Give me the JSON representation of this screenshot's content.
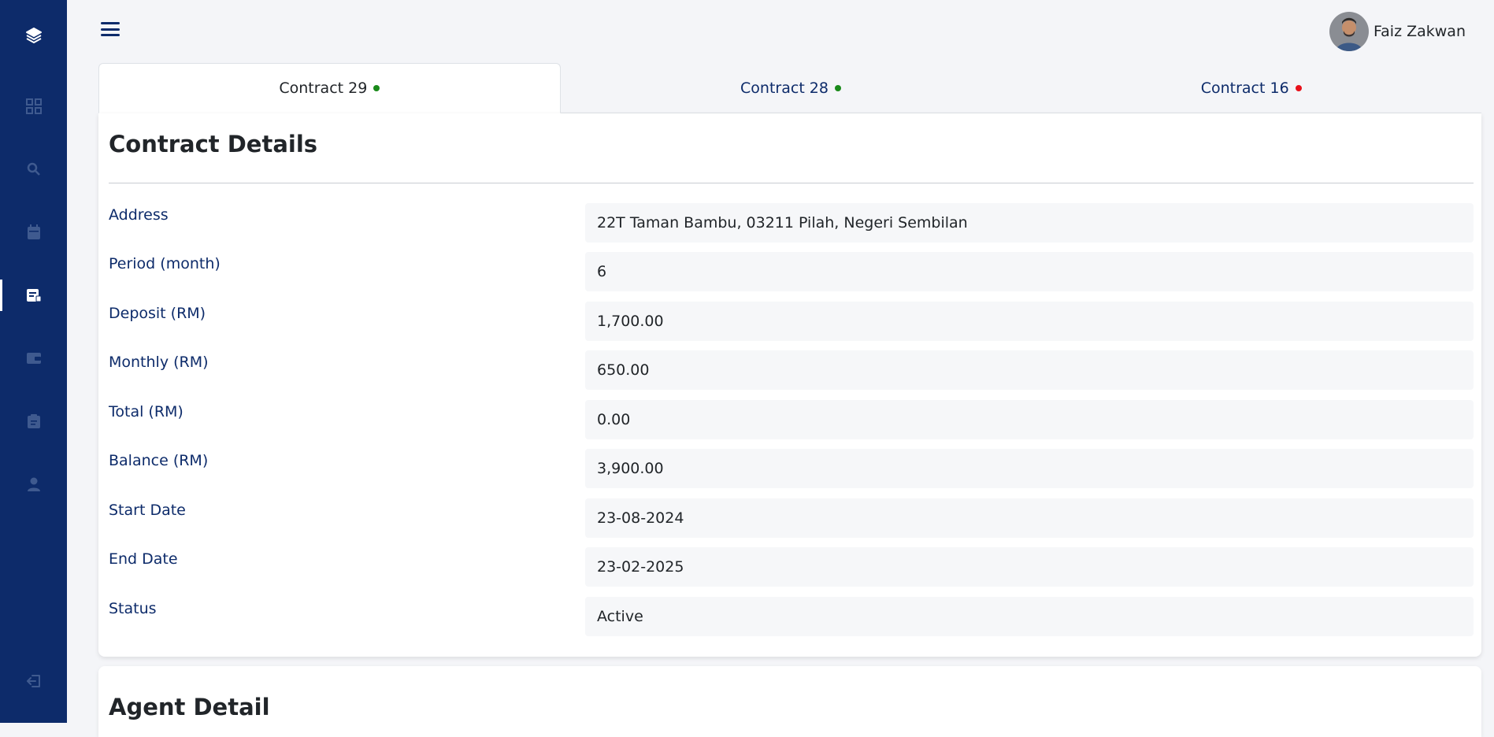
{
  "sidebar": {
    "logo_icon": "layers-icon",
    "items": [
      {
        "icon": "dashboard-grid-icon",
        "active": false
      },
      {
        "icon": "search-icon",
        "active": false
      },
      {
        "icon": "calendar-icon",
        "active": false
      },
      {
        "icon": "contract-receipt-icon",
        "active": true
      },
      {
        "icon": "wallet-icon",
        "active": false
      },
      {
        "icon": "clipboard-icon",
        "active": false
      },
      {
        "icon": "user-icon",
        "active": false
      }
    ],
    "logout_icon": "logout-icon"
  },
  "header": {
    "menu_icon": "hamburger-menu-icon",
    "user_name": "Faiz Zakwan"
  },
  "tabs": [
    {
      "label": "Contract 29",
      "status_color": "#1a8a1a",
      "active": true
    },
    {
      "label": "Contract 28",
      "status_color": "#1a8a1a",
      "active": false
    },
    {
      "label": "Contract 16",
      "status_color": "#e8101a",
      "active": false
    }
  ],
  "contract_details": {
    "title": "Contract Details",
    "fields": [
      {
        "label": "Address",
        "value": "22T Taman Bambu, 03211 Pilah, Negeri Sembilan"
      },
      {
        "label": "Period (month)",
        "value": "6"
      },
      {
        "label": "Deposit (RM)",
        "value": "1,700.00"
      },
      {
        "label": "Monthly (RM)",
        "value": "650.00"
      },
      {
        "label": "Total (RM)",
        "value": "0.00"
      },
      {
        "label": "Balance (RM)",
        "value": "3,900.00"
      },
      {
        "label": "Start Date",
        "value": "23-08-2024"
      },
      {
        "label": "End Date",
        "value": "23-02-2025"
      },
      {
        "label": "Status",
        "value": "Active"
      }
    ]
  },
  "agent_detail": {
    "title": "Agent Detail"
  },
  "colors": {
    "primary": "#0d2b6a",
    "background": "#f4f5f8",
    "card": "#ffffff",
    "field_bg": "#f6f7f9",
    "sidebar_icon": "#3f5a8f",
    "active_dot": "#1a8a1a",
    "inactive_dot": "#e8101a"
  }
}
